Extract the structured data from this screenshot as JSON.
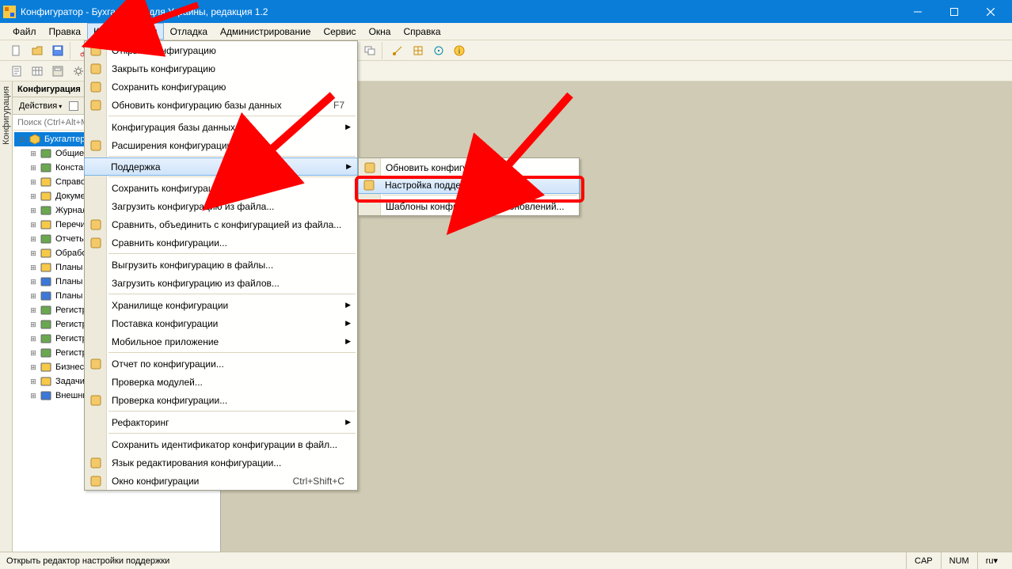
{
  "title": "Конфигуратор - Бухгалтерия для Украины, редакция 1.2",
  "menubar": [
    "Файл",
    "Правка",
    "Конфигурация",
    "Отладка",
    "Администрирование",
    "Сервис",
    "Окна",
    "Справка"
  ],
  "menubar_active_index": 2,
  "panel": {
    "title": "Конфигурация",
    "actions_label": "Действия",
    "search_placeholder": "Поиск (Ctrl+Alt+M)"
  },
  "tree": {
    "root": "Бухгалтерия",
    "items": [
      "Общие",
      "Константы",
      "Справочники",
      "Документы",
      "Журналы",
      "Перечисления",
      "Отчеты",
      "Обработки",
      "Планы видов характеристик",
      "Планы счетов",
      "Планы видов расчета",
      "Регистры сведений",
      "Регистры накопления",
      "Регистры бухгалтерии",
      "Регистры расчета",
      "Бизнес-процессы",
      "Задачи",
      "Внешние источники данных"
    ]
  },
  "config_menu": [
    {
      "label": "Открыть конфигурацию",
      "icon": "open-config-icon"
    },
    {
      "label": "Закрыть конфигурацию",
      "icon": "close-config-icon"
    },
    {
      "label": "Сохранить конфигурацию",
      "icon": "save-config-icon"
    },
    {
      "label": "Обновить конфигурацию базы данных",
      "icon": "update-db-icon",
      "hotkey": "F7"
    },
    {
      "sep": true
    },
    {
      "label": "Конфигурация базы данных",
      "submenu": true
    },
    {
      "label": "Расширения конфигурации",
      "icon": "extensions-icon"
    },
    {
      "sep": true
    },
    {
      "label": "Поддержка",
      "submenu": true,
      "hover": true
    },
    {
      "sep": true
    },
    {
      "label": "Сохранить конфигурацию в файл..."
    },
    {
      "label": "Загрузить конфигурацию из файла..."
    },
    {
      "label": "Сравнить, объединить с конфигурацией из файла...",
      "icon": "compare-merge-icon"
    },
    {
      "label": "Сравнить конфигурации...",
      "icon": "compare-icon"
    },
    {
      "sep": true
    },
    {
      "label": "Выгрузить конфигурацию в файлы..."
    },
    {
      "label": "Загрузить конфигурацию из файлов..."
    },
    {
      "sep": true
    },
    {
      "label": "Хранилище конфигурации",
      "submenu": true
    },
    {
      "label": "Поставка конфигурации",
      "submenu": true
    },
    {
      "label": "Мобильное приложение",
      "submenu": true
    },
    {
      "sep": true
    },
    {
      "label": "Отчет по конфигурации...",
      "icon": "report-icon"
    },
    {
      "label": "Проверка модулей..."
    },
    {
      "label": "Проверка конфигурации...",
      "icon": "check-icon"
    },
    {
      "sep": true
    },
    {
      "label": "Рефакторинг",
      "submenu": true
    },
    {
      "sep": true
    },
    {
      "label": "Сохранить идентификатор конфигурации в файл..."
    },
    {
      "label": "Язык редактирования конфигурации...",
      "icon": "lang-icon"
    },
    {
      "label": "Окно конфигурации",
      "icon": "window-icon",
      "hotkey": "Ctrl+Shift+C"
    }
  ],
  "support_submenu": [
    {
      "label": "Обновить конфигурацию...",
      "icon": "refresh-icon"
    },
    {
      "label": "Настройка поддержки...",
      "icon": "support-settings-icon",
      "hover": true,
      "highlight": true
    },
    {
      "sep": true
    },
    {
      "label": "Шаблоны конфигураций и обновлений..."
    }
  ],
  "status": {
    "hint": "Открыть редактор настройки поддержки",
    "caps": "CAP",
    "num": "NUM",
    "lang": "ru"
  },
  "vert_tab": "Конфигурация"
}
